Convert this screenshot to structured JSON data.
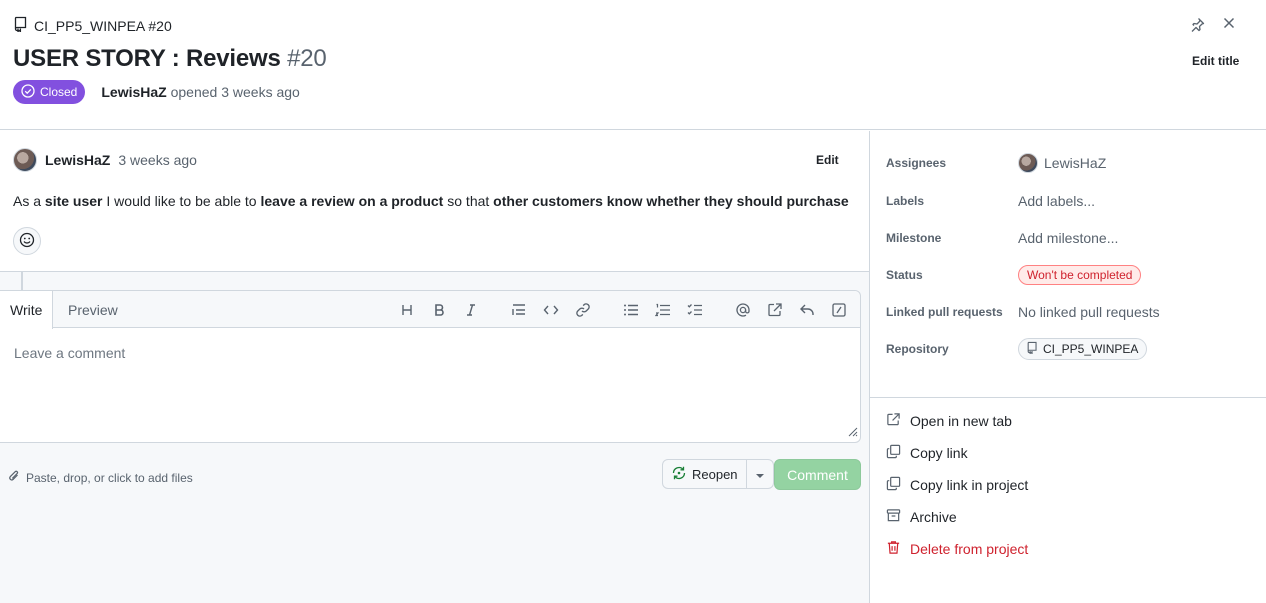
{
  "header": {
    "repo_ref": "CI_PP5_WINPEA #20",
    "title": "USER STORY : Reviews",
    "number": "#20",
    "edit_title": "Edit title",
    "state_badge": "Closed",
    "author": "LewisHaZ",
    "opened_text": "opened 3 weeks ago"
  },
  "comment": {
    "author": "LewisHaZ",
    "time": "3 weeks ago",
    "edit": "Edit",
    "body": {
      "p1": "As a ",
      "b1": "site user",
      "p2": " I would like to be able to ",
      "b2": "leave a review on a product",
      "p3": " so that ",
      "b3": "other customers know whether they should purchase"
    }
  },
  "editor": {
    "tab_write": "Write",
    "tab_preview": "Preview",
    "placeholder": "Leave a comment",
    "attach_text": "Paste, drop, or click to add files",
    "reopen_label": "Reopen",
    "comment_label": "Comment",
    "toolbar_icons": [
      "heading-icon",
      "bold-icon",
      "italic-icon",
      "quote-icon",
      "code-icon",
      "link-icon",
      "bulleted-list-icon",
      "numbered-list-icon",
      "task-list-icon",
      "mention-icon",
      "cross-reference-icon",
      "reply-icon",
      "slash-commands-icon"
    ]
  },
  "sidebar": {
    "assignees_label": "Assignees",
    "assignee": "LewisHaZ",
    "labels_label": "Labels",
    "labels_value": "Add labels...",
    "milestone_label": "Milestone",
    "milestone_value": "Add milestone...",
    "status_label": "Status",
    "status_value": "Won't be completed",
    "linked_label": "Linked pull requests",
    "linked_value": "No linked pull requests",
    "repository_label": "Repository",
    "repository_value": "CI_PP5_WINPEA",
    "actions": {
      "open_new_tab": "Open in new tab",
      "copy_link": "Copy link",
      "copy_link_project": "Copy link in project",
      "archive": "Archive",
      "delete": "Delete from project"
    }
  },
  "colors": {
    "closed_badge": "#8250df",
    "danger": "#cf222e",
    "comment_button_disabled": "#94d3a2",
    "border": "#d0d7de"
  }
}
